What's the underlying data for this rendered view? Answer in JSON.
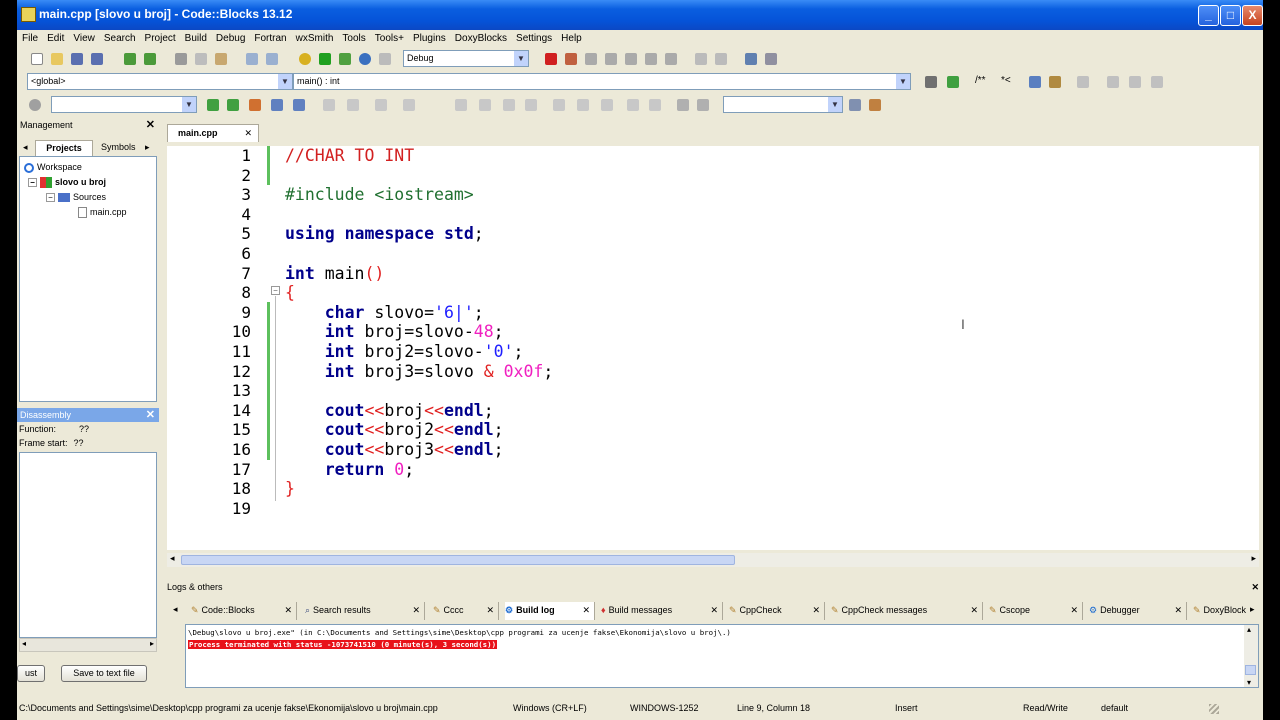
{
  "window": {
    "title": "main.cpp [slovo u broj] - Code::Blocks 13.12",
    "minimize": "_",
    "maximize": "□",
    "close": "X"
  },
  "menu": [
    "File",
    "Edit",
    "View",
    "Search",
    "Project",
    "Build",
    "Debug",
    "Fortran",
    "wxSmith",
    "Tools",
    "Tools+",
    "Plugins",
    "DoxyBlocks",
    "Settings",
    "Help"
  ],
  "toolbar": {
    "build_target": "Debug",
    "scope": "<global>",
    "function": "main() : int",
    "symbols1": "/**",
    "symbols2": "*<"
  },
  "management": {
    "title": "Management",
    "tab_projects": "Projects",
    "tab_symbols": "Symbols",
    "workspace": "Workspace",
    "project": "slovo u broj",
    "sources": "Sources",
    "file": "main.cpp"
  },
  "disassembly": {
    "title": "Disassembly",
    "function_label": "Function:",
    "function_value": "??",
    "frame_label": "Frame start:",
    "frame_value": "??",
    "button_left": "ust",
    "button_save": "Save to text file"
  },
  "editor": {
    "tab": "main.cpp",
    "lines": [
      "1",
      "2",
      "3",
      "4",
      "5",
      "6",
      "7",
      "8",
      "9",
      "10",
      "11",
      "12",
      "13",
      "14",
      "15",
      "16",
      "17",
      "18",
      "19"
    ]
  },
  "logs": {
    "title": "Logs & others",
    "tabs": [
      "Code::Blocks",
      "Search results",
      "Cccc",
      "Build log",
      "Build messages",
      "CppCheck",
      "CppCheck messages",
      "Cscope",
      "Debugger",
      "DoxyBlock"
    ],
    "line1": "\\Debug\\slovo u broj.exe\"  (in C:\\Documents and Settings\\sime\\Desktop\\cpp programi za ucenje fakse\\Ekonomija\\slovo u broj\\.)",
    "line2": "Process terminated with status -1073741510 (0 minute(s), 3 second(s))"
  },
  "status": {
    "path": "C:\\Documents and Settings\\sime\\Desktop\\cpp programi za ucenje fakse\\Ekonomija\\slovo u broj\\main.cpp",
    "eol": "Windows (CR+LF)",
    "encoding": "WINDOWS-1252",
    "position": "Line 9, Column 18",
    "mode": "Insert",
    "access": "Read/Write",
    "lang": "default"
  },
  "colors": {
    "title_bar": "#0553D8",
    "keyword": "#00008B",
    "comment": "#D22020",
    "number": "#F020C0",
    "error_bg": "#E8121A"
  }
}
